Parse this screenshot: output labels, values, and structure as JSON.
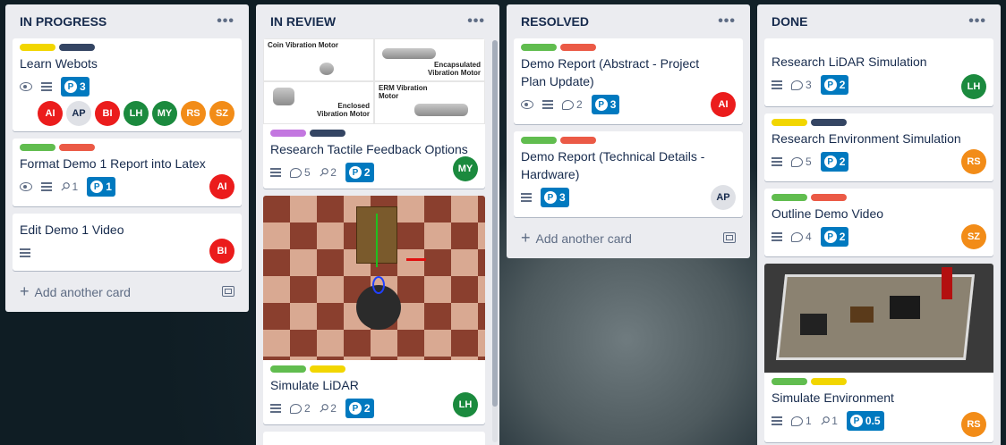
{
  "lists": [
    {
      "title": "IN PROGRESS",
      "cards": [
        {
          "labels": [
            "#f2d600",
            "#344563"
          ],
          "title": "Learn Webots",
          "badges": {
            "points": "3"
          },
          "avatars": [
            {
              "initials": "AI",
              "color": "#eb1c1c"
            },
            {
              "initials": "AP",
              "color": "#dfe1e6"
            },
            {
              "initials": "BI",
              "color": "#eb1c1c"
            },
            {
              "initials": "LH",
              "color": "#1b8a3e"
            },
            {
              "initials": "MY",
              "color": "#1b8a3e"
            },
            {
              "initials": "RS",
              "color": "#f28c18"
            },
            {
              "initials": "SZ",
              "color": "#f28c18"
            }
          ]
        },
        {
          "labels": [
            "#61bd4f",
            "#eb5a46"
          ],
          "title": "Format Demo 1 Report into Latex",
          "badges": {
            "attachments": "1",
            "points": "1"
          },
          "avatar": {
            "initials": "AI",
            "color": "#eb1c1c"
          }
        },
        {
          "labels": [],
          "title": "Edit Demo 1 Video",
          "avatar": {
            "initials": "BI",
            "color": "#eb1c1c"
          }
        }
      ],
      "add_card": "Add another card"
    },
    {
      "title": "IN REVIEW",
      "cards": [
        {
          "labels": [
            "#c377e0",
            "#344563"
          ],
          "title": "Research Tactile Feedback Options",
          "badges": {
            "comments": "5",
            "attachments": "2",
            "points": "2"
          },
          "avatar": {
            "initials": "MY",
            "color": "#1b8a3e"
          },
          "image_labels": [
            "Coin Vibration Motor",
            "Encapsulated Vibration Motor",
            "Enclosed Vibration Motor",
            "ERM Vibration Motor"
          ]
        },
        {
          "labels": [
            "#61bd4f",
            "#f2d600"
          ],
          "title": "Simulate LiDAR",
          "badges": {
            "comments": "2",
            "attachments": "2",
            "points": "2"
          },
          "avatar": {
            "initials": "LH",
            "color": "#1b8a3e"
          }
        }
      ]
    },
    {
      "title": "RESOLVED",
      "cards": [
        {
          "labels": [
            "#61bd4f",
            "#eb5a46"
          ],
          "title": "Demo Report (Abstract - Project Plan Update)",
          "badges": {
            "comments": "2",
            "points": "3"
          },
          "avatar": {
            "initials": "AI",
            "color": "#eb1c1c"
          }
        },
        {
          "labels": [
            "#61bd4f",
            "#eb5a46"
          ],
          "title": "Demo Report (Technical Details - Hardware)",
          "badges": {
            "points": "3"
          },
          "avatar": {
            "initials": "AP",
            "color": "#dfe1e6"
          }
        }
      ],
      "add_card": "Add another card"
    },
    {
      "title": "DONE",
      "cards": [
        {
          "labels": [],
          "title": "Research LiDAR Simulation",
          "badges": {
            "comments": "3",
            "points": "2"
          },
          "avatar": {
            "initials": "LH",
            "color": "#1b8a3e"
          }
        },
        {
          "labels": [
            "#f2d600",
            "#344563"
          ],
          "title": "Research Environment Simulation",
          "badges": {
            "comments": "5",
            "points": "2"
          },
          "avatar": {
            "initials": "RS",
            "color": "#f28c18"
          }
        },
        {
          "labels": [
            "#61bd4f",
            "#eb5a46"
          ],
          "title": "Outline Demo Video",
          "badges": {
            "comments": "4",
            "points": "2"
          },
          "avatar": {
            "initials": "SZ",
            "color": "#f28c18"
          }
        },
        {
          "labels": [
            "#61bd4f",
            "#f2d600"
          ],
          "title": "Simulate Environment",
          "badges": {
            "comments": "1",
            "attachments": "1",
            "points": "0.5"
          },
          "avatar": {
            "initials": "RS",
            "color": "#f28c18"
          }
        }
      ]
    }
  ],
  "menu_icon": "more-horizontal-icon"
}
